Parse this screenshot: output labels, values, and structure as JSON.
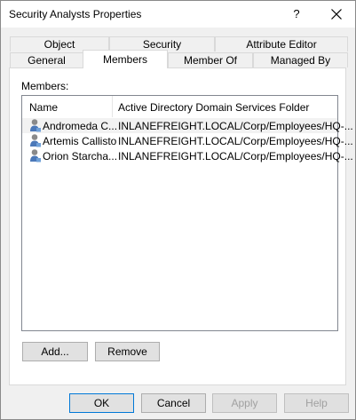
{
  "window": {
    "title": "Security Analysts Properties",
    "help_glyph": "?"
  },
  "tabs_row1": [
    {
      "label": "Object"
    },
    {
      "label": "Security"
    },
    {
      "label": "Attribute Editor"
    }
  ],
  "tabs_row2": [
    {
      "label": "General"
    },
    {
      "label": "Members",
      "active": true
    },
    {
      "label": "Member Of"
    },
    {
      "label": "Managed By"
    }
  ],
  "members": {
    "label": "Members:",
    "columns": [
      "Name",
      "Active Directory Domain Services Folder"
    ],
    "rows": [
      {
        "name": "Andromeda C...",
        "folder": "INLANEFREIGHT.LOCAL/Corp/Employees/HQ-..."
      },
      {
        "name": "Artemis Callisto",
        "folder": "INLANEFREIGHT.LOCAL/Corp/Employees/HQ-..."
      },
      {
        "name": "Orion Starcha...",
        "folder": "INLANEFREIGHT.LOCAL/Corp/Employees/HQ-..."
      }
    ],
    "add_label": "Add...",
    "remove_label": "Remove"
  },
  "footer": {
    "ok_label": "OK",
    "cancel_label": "Cancel",
    "apply_label": "Apply",
    "help_label": "Help"
  },
  "icons": {
    "user": "user-icon",
    "close": "close-icon"
  }
}
